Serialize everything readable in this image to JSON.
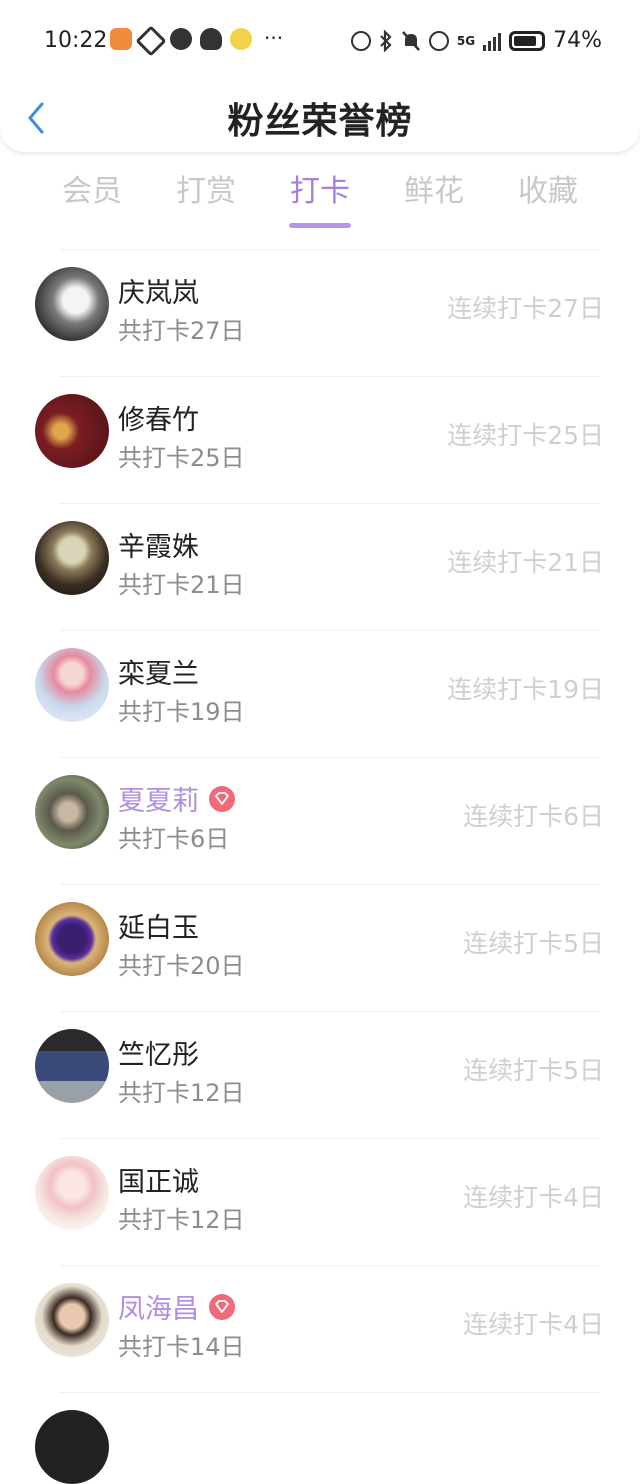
{
  "status_bar": {
    "time": "10:22",
    "battery": "74%",
    "network": "5G",
    "icons": [
      "taobao-icon",
      "wings-app-icon",
      "wechat-icon",
      "qq-icon",
      "weather-app-icon",
      "more-dots-icon",
      "alarm-icon",
      "bluetooth-icon",
      "mute-icon",
      "hd-call-icon",
      "signal-icon",
      "battery-icon"
    ]
  },
  "header": {
    "title": "粉丝荣誉榜",
    "back_icon": "chevron-left-icon"
  },
  "tabs": [
    {
      "label": "会员",
      "active": false
    },
    {
      "label": "打赏",
      "active": false
    },
    {
      "label": "打卡",
      "active": true
    },
    {
      "label": "鲜花",
      "active": false
    },
    {
      "label": "收藏",
      "active": false
    }
  ],
  "colors": {
    "accent": "#a57ee0",
    "vip_name": "#b18ee0",
    "vip_badge": "#f06b7a",
    "muted": "#cfcfcf"
  },
  "rows": [
    {
      "name": "庆岚岚",
      "total": "共打卡27日",
      "streak": "连续打卡27日",
      "vip": false
    },
    {
      "name": "修春竹",
      "total": "共打卡25日",
      "streak": "连续打卡25日",
      "vip": false
    },
    {
      "name": "辛霞姝",
      "total": "共打卡21日",
      "streak": "连续打卡21日",
      "vip": false
    },
    {
      "name": "栾夏兰",
      "total": "共打卡19日",
      "streak": "连续打卡19日",
      "vip": false
    },
    {
      "name": "夏夏莉",
      "total": "共打卡6日",
      "streak": "连续打卡6日",
      "vip": true
    },
    {
      "name": "延白玉",
      "total": "共打卡20日",
      "streak": "连续打卡5日",
      "vip": false
    },
    {
      "name": "竺忆彤",
      "total": "共打卡12日",
      "streak": "连续打卡5日",
      "vip": false
    },
    {
      "name": "国正诚",
      "total": "共打卡12日",
      "streak": "连续打卡4日",
      "vip": false
    },
    {
      "name": "凤海昌",
      "total": "共打卡14日",
      "streak": "连续打卡4日",
      "vip": true
    }
  ]
}
